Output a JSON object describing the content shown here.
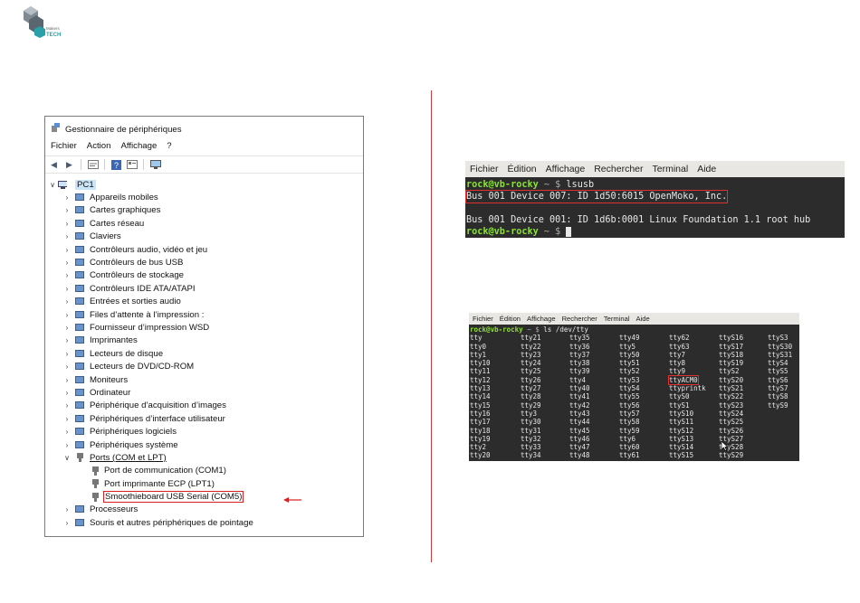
{
  "logo": {
    "text_top": "Makers",
    "text_bottom": "TECH"
  },
  "device_manager": {
    "title": "Gestionnaire de périphériques",
    "menu": [
      "Fichier",
      "Action",
      "Affichage",
      "?"
    ],
    "root": "PC1",
    "categories": [
      {
        "label": "Appareils mobiles",
        "icon": "phone-icon"
      },
      {
        "label": "Cartes graphiques",
        "icon": "display-adapter-icon"
      },
      {
        "label": "Cartes réseau",
        "icon": "network-icon"
      },
      {
        "label": "Claviers",
        "icon": "keyboard-icon"
      },
      {
        "label": "Contrôleurs audio, vidéo et jeu",
        "icon": "speaker-icon"
      },
      {
        "label": "Contrôleurs de bus USB",
        "icon": "usb-icon"
      },
      {
        "label": "Contrôleurs de stockage",
        "icon": "storage-icon"
      },
      {
        "label": "Contrôleurs IDE ATA/ATAPI",
        "icon": "ide-icon"
      },
      {
        "label": "Entrées et sorties audio",
        "icon": "speaker-icon"
      },
      {
        "label": "Files d’attente à l’impression :",
        "icon": "printer-icon"
      },
      {
        "label": "Fournisseur d’impression WSD",
        "icon": "printer-icon"
      },
      {
        "label": "Imprimantes",
        "icon": "printer-icon"
      },
      {
        "label": "Lecteurs de disque",
        "icon": "disk-icon"
      },
      {
        "label": "Lecteurs de DVD/CD-ROM",
        "icon": "dvd-icon"
      },
      {
        "label": "Moniteurs",
        "icon": "monitor-icon"
      },
      {
        "label": "Ordinateur",
        "icon": "computer-icon"
      },
      {
        "label": "Périphérique d’acquisition d’images",
        "icon": "camera-icon"
      },
      {
        "label": "Périphériques d’interface utilisateur",
        "icon": "hid-icon"
      },
      {
        "label": "Périphériques logiciels",
        "icon": "software-icon"
      },
      {
        "label": "Périphériques système",
        "icon": "system-icon"
      }
    ],
    "ports": {
      "label": "Ports (COM et LPT)",
      "children": [
        "Port de communication (COM1)",
        "Port imprimante ECP (LPT1)",
        "Smoothieboard USB Serial (COM5)"
      ]
    },
    "after_ports": [
      {
        "label": "Processeurs",
        "icon": "processor-icon"
      },
      {
        "label": "Souris et autres périphériques de pointage",
        "icon": "mouse-icon"
      }
    ]
  },
  "terminal1": {
    "menu": [
      "Fichier",
      "Édition",
      "Affichage",
      "Rechercher",
      "Terminal",
      "Aide"
    ],
    "prompt_user": "rock@vb-rocky",
    "prompt_path": "~ $",
    "command": "lsusb",
    "output_highlight": "Bus 001 Device 007: ID 1d50:6015 OpenMoko, Inc.",
    "output_2": "Bus 001 Device 001: ID 1d6b:0001 Linux Foundation 1.1 root hub"
  },
  "terminal2": {
    "menu": [
      "Fichier",
      "Édition",
      "Affichage",
      "Rechercher",
      "Terminal",
      "Aide"
    ],
    "prompt_user": "rock@vb-rocky",
    "prompt_path": "~ $",
    "command": "ls /dev/tty",
    "highlight": "ttyACM0",
    "grid": [
      [
        "tty",
        "tty21",
        "tty35",
        "tty49",
        "tty62",
        "ttyS16",
        "ttyS3"
      ],
      [
        "tty0",
        "tty22",
        "tty36",
        "tty5",
        "tty63",
        "ttyS17",
        "ttyS30"
      ],
      [
        "tty1",
        "tty23",
        "tty37",
        "tty50",
        "tty7",
        "ttyS18",
        "ttyS31"
      ],
      [
        "tty10",
        "tty24",
        "tty38",
        "tty51",
        "tty8",
        "ttyS19",
        "ttyS4"
      ],
      [
        "tty11",
        "tty25",
        "tty39",
        "tty52",
        "tty9",
        "ttyS2",
        "ttyS5"
      ],
      [
        "tty12",
        "tty26",
        "tty4",
        "tty53",
        "ttyACM0",
        "ttyS20",
        "ttyS6"
      ],
      [
        "tty13",
        "tty27",
        "tty40",
        "tty54",
        "ttyprintk",
        "ttyS21",
        "ttyS7"
      ],
      [
        "tty14",
        "tty28",
        "tty41",
        "tty55",
        "ttyS0",
        "ttyS22",
        "ttyS8"
      ],
      [
        "tty15",
        "tty29",
        "tty42",
        "tty56",
        "ttyS1",
        "ttyS23",
        "ttyS9"
      ],
      [
        "tty16",
        "tty3",
        "tty43",
        "tty57",
        "ttyS10",
        "ttyS24",
        ""
      ],
      [
        "tty17",
        "tty30",
        "tty44",
        "tty58",
        "ttyS11",
        "ttyS25",
        ""
      ],
      [
        "tty18",
        "tty31",
        "tty45",
        "tty59",
        "ttyS12",
        "ttyS26",
        ""
      ],
      [
        "tty19",
        "tty32",
        "tty46",
        "tty6",
        "ttyS13",
        "ttyS27",
        ""
      ],
      [
        "tty2",
        "tty33",
        "tty47",
        "tty60",
        "ttyS14",
        "ttyS28",
        ""
      ],
      [
        "tty20",
        "tty34",
        "tty48",
        "tty61",
        "ttyS15",
        "ttyS29",
        ""
      ]
    ]
  },
  "colors": {
    "highlight_red": "#d81f1f",
    "terminal_bg": "#2c2c2c",
    "prompt_green": "#8ae234"
  }
}
